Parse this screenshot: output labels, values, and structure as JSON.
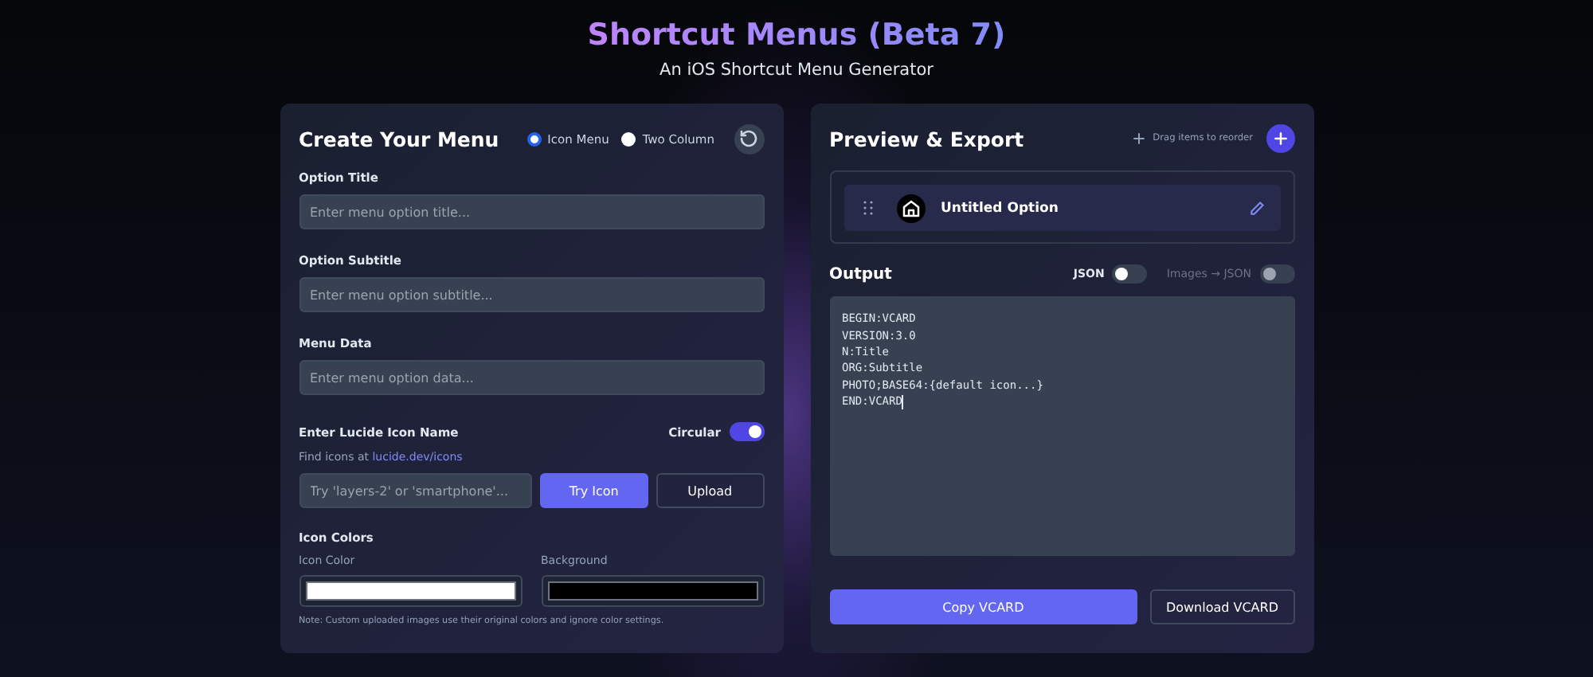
{
  "header": {
    "title": "Shortcut Menus (Beta 7)",
    "subtitle": "An iOS Shortcut Menu Generator"
  },
  "editor": {
    "title": "Create Your Menu",
    "modes": [
      {
        "label": "Icon Menu",
        "selected": true
      },
      {
        "label": "Two Column",
        "selected": false
      }
    ],
    "fields": [
      {
        "label": "Option Title",
        "placeholder": "Enter menu option title..."
      },
      {
        "label": "Option Subtitle",
        "placeholder": "Enter menu option subtitle..."
      },
      {
        "label": "Menu Data",
        "placeholder": "Enter menu option data..."
      }
    ],
    "icon_name": {
      "label": "Enter Lucide Icon Name",
      "circular": {
        "label": "Circular",
        "on": true
      },
      "hint": "Find icons at",
      "link": "lucide.dev/icons",
      "placeholder": "Try 'layers-2' or 'smartphone'...",
      "try_button": "Try Icon",
      "upload_button": "Upload"
    },
    "icon_colors": {
      "label": "Icon Colors",
      "swatches": [
        {
          "label": "Icon Color",
          "color": "#ffffff"
        },
        {
          "label": "Background",
          "color": "#000000"
        }
      ],
      "note": "Note: Custom uploaded images use their original colors and ignore color settings."
    }
  },
  "preview": {
    "title": "Preview & Export",
    "drag_hint": "Drag items to reorder",
    "items": [
      {
        "title": "Untitled Option"
      }
    ],
    "output_title": "Output",
    "toggles": [
      {
        "label": "JSON",
        "on": false,
        "disabled": false
      },
      {
        "label": "Images → JSON",
        "on": false,
        "disabled": true
      }
    ],
    "output_lines": [
      "BEGIN:VCARD",
      "VERSION:3.0",
      "N:Title",
      "ORG:Subtitle",
      "PHOTO;BASE64:{default icon...}",
      "END:VCARD"
    ],
    "copy_button": "Copy VCARD",
    "download_button": "Download VCARD"
  }
}
